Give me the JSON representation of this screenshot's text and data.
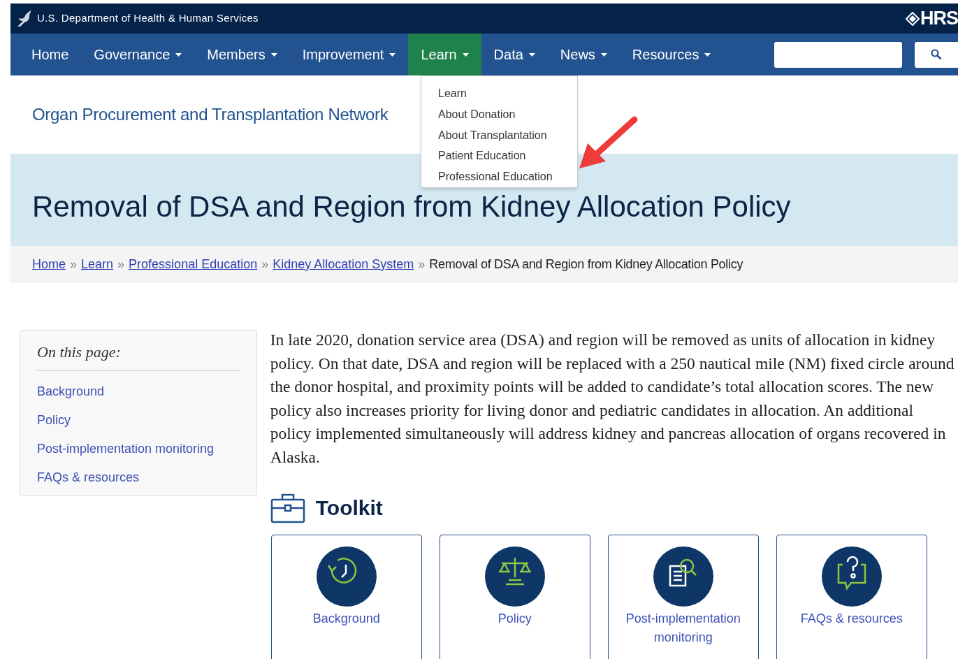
{
  "agency_bar": {
    "title": "U.S. Department of Health & Human Services",
    "logo_text": "HRS"
  },
  "nav": {
    "items": [
      {
        "label": "Home",
        "has_menu": false,
        "selected": false
      },
      {
        "label": "Governance",
        "has_menu": true,
        "selected": false
      },
      {
        "label": "Members",
        "has_menu": true,
        "selected": false
      },
      {
        "label": "Improvement",
        "has_menu": true,
        "selected": false
      },
      {
        "label": "Learn",
        "has_menu": true,
        "selected": true
      },
      {
        "label": "Data",
        "has_menu": true,
        "selected": false
      },
      {
        "label": "News",
        "has_menu": true,
        "selected": false
      },
      {
        "label": "Resources",
        "has_menu": true,
        "selected": false
      }
    ]
  },
  "dropdown": {
    "items": [
      "Learn",
      "About Donation",
      "About Transplantation",
      "Patient Education",
      "Professional Education"
    ]
  },
  "site_name": "Organ Procurement and Transplantation Network",
  "page_title": "Removal of DSA and Region from Kidney Allocation Policy",
  "breadcrumb": {
    "links": [
      "Home",
      "Learn",
      "Professional Education",
      "Kidney Allocation System"
    ],
    "separator": "»",
    "current": "Removal of DSA and Region from Kidney Allocation Policy"
  },
  "on_this_page": {
    "heading": "On this page:",
    "links": [
      "Background",
      "Policy",
      "Post-implementation monitoring",
      "FAQs & resources"
    ]
  },
  "intro": "In late 2020, donation service area (DSA) and region will be removed as units of allocation in kidney policy. On that date, DSA and region will be replaced with a 250 nautical mile (NM) fixed circle around the donor hospital, and proximity points will be added to candidate’s total allocation scores. The new policy also increases priority for living donor and pediatric candidates in allocation. An additional policy implemented simultaneously will address kidney and pancreas allocation of organs recovered in Alaska.",
  "toolkit": {
    "heading": "Toolkit",
    "cards": [
      {
        "kind": "clock",
        "label": "Background"
      },
      {
        "kind": "scales",
        "label": "Policy"
      },
      {
        "kind": "document",
        "label": "Post-implementation monitoring"
      },
      {
        "kind": "question",
        "label": "FAQs & resources"
      }
    ]
  }
}
